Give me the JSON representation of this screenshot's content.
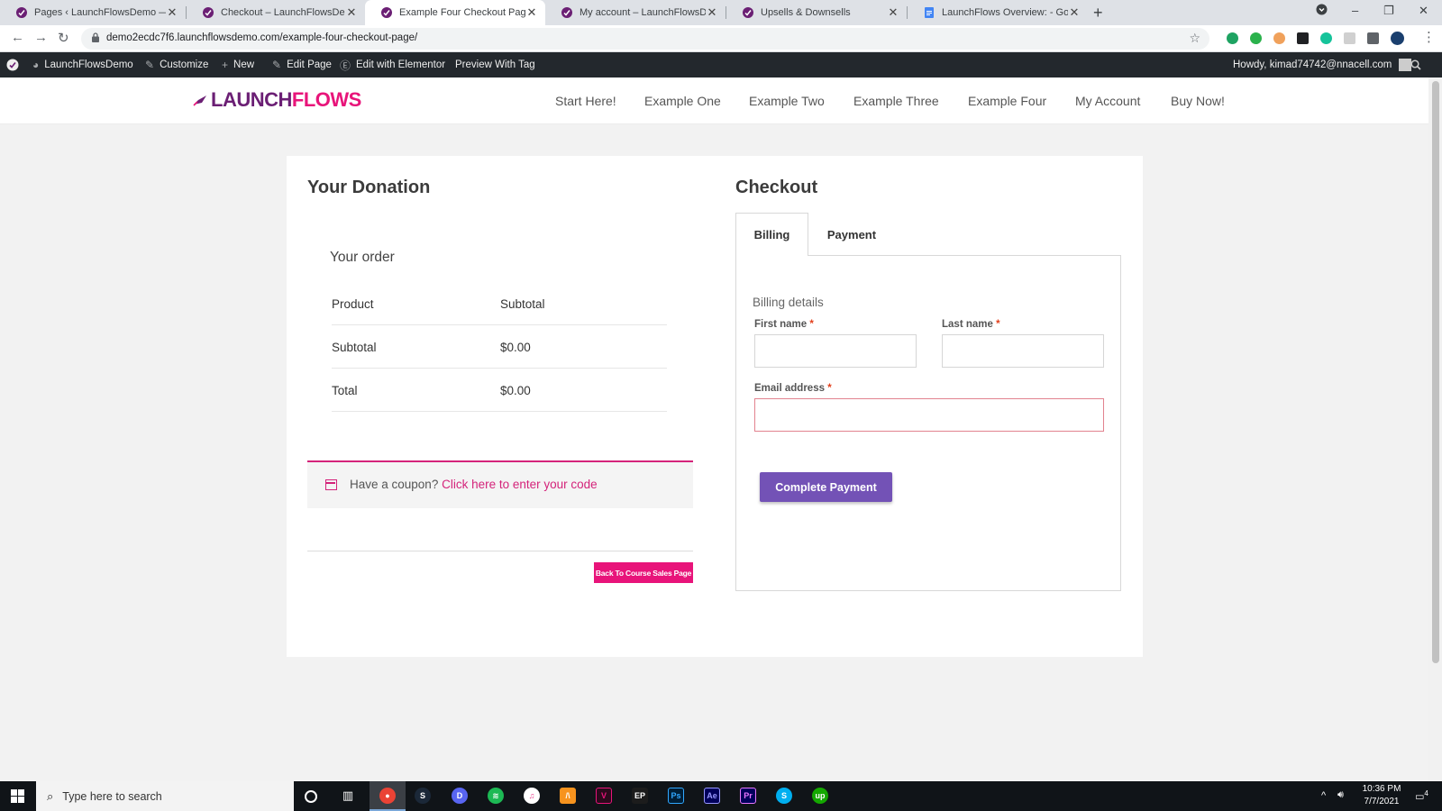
{
  "browser": {
    "tabs": [
      {
        "title": "Pages ‹ LaunchFlowsDemo — Yo",
        "active": false
      },
      {
        "title": "Checkout – LaunchFlowsDemo",
        "active": false
      },
      {
        "title": "Example Four Checkout Page – L",
        "active": true
      },
      {
        "title": "My account – LaunchFlowsDemo",
        "active": false
      },
      {
        "title": "Upsells & Downsells",
        "active": false
      },
      {
        "title": "LaunchFlows Overview: - Google",
        "active": false
      }
    ],
    "url": "demo2ecdc7f6.launchflowsdemo.com/example-four-checkout-page/"
  },
  "adminbar": {
    "site_name": "LaunchFlowsDemo",
    "customize": "Customize",
    "new": "New",
    "edit_page": "Edit Page",
    "edit_elementor": "Edit with Elementor",
    "preview_tag": "Preview With Tag",
    "howdy": "Howdy, kimad74742@nnacell.com"
  },
  "site": {
    "logo_part1": "LAUNCH",
    "logo_part2": "FLOWS",
    "nav": [
      "Start Here!",
      "Example One",
      "Example Two",
      "Example Three",
      "Example Four",
      "My Account",
      "Buy Now!"
    ]
  },
  "donation": {
    "title": "Your Donation",
    "your_order": "Your order",
    "headers": [
      "Product",
      "Subtotal"
    ],
    "rows": [
      {
        "label": "Subtotal",
        "value": "$0.00"
      },
      {
        "label": "Total",
        "value": "$0.00"
      }
    ],
    "coupon_text": "Have a coupon?",
    "coupon_link": "Click here to enter your code",
    "back_button": "Back To Course Sales Page"
  },
  "checkout": {
    "title": "Checkout",
    "tabs": [
      "Billing",
      "Payment"
    ],
    "billing_details": "Billing details",
    "first_name_label": "First name",
    "last_name_label": "Last name",
    "email_label": "Email address",
    "required_mark": "*",
    "first_name_value": "",
    "last_name_value": "",
    "email_value": "",
    "complete_button": "Complete Payment"
  },
  "taskbar": {
    "search_placeholder": "Type here to search",
    "time": "10:36 PM",
    "date": "7/7/2021",
    "notifications": "4"
  },
  "colors": {
    "brand_purple": "#6b1f74",
    "brand_pink": "#e8147a",
    "button_purple": "#7352b6",
    "admin_bar": "#23282d"
  }
}
